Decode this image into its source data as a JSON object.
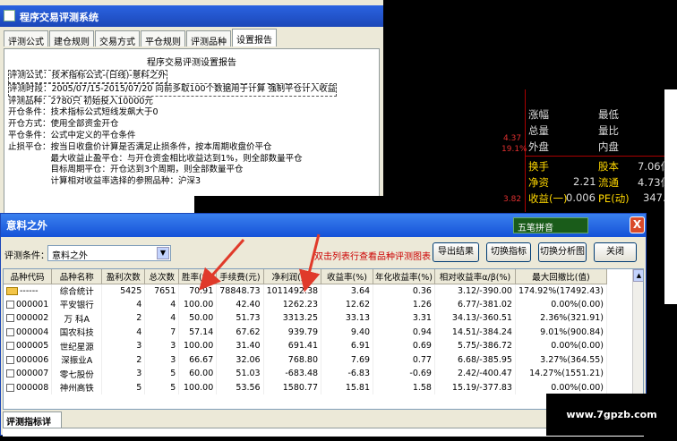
{
  "back_window": {
    "title": "程序交易评测系统",
    "tabs": [
      "评测公式",
      "建仓规则",
      "交易方式",
      "平仓规则",
      "评测品种",
      "设置报告"
    ],
    "report_title": "程序交易评测设置报告",
    "lines": [
      "评测公式：技术指标公式-(日线)-意料之外",
      "评测时段：2005/07/15-2015/07/20  向前多取100个数据用于计算  强制平仓计入收益",
      "评测品种：2780只  初始投入10000元",
      "开仓条件：技术指标公式短线发飙大于0",
      "开仓方式：使用全部资金开仓",
      "平仓条件：公式中定义的平仓条件",
      "止损平仓：按当日收盘价计算是否满足止损条件，按本周期收盘价平仓",
      "　　　　　最大收益止盈平仓：与开仓资金相比收益达到1%，则全部数量平仓",
      "　　　　　目标周期平仓：开仓达到3个周期，则全部数量平仓",
      "　　　　　计算相对收益率选择的参照品种：沪深3"
    ]
  },
  "stock_panel": {
    "items": [
      {
        "label": "涨幅",
        "label2": "最低"
      },
      {
        "label": "总量",
        "label2": "量比"
      },
      {
        "label": "外盘",
        "label2": "内盘"
      },
      {
        "label": "换手",
        "label2": "股本",
        "value2": "7.06亿"
      },
      {
        "label": "净资",
        "value": "2.21",
        "label2": "流通",
        "value2": "4.73亿"
      },
      {
        "label": "收益(一)",
        "value": "0.006",
        "label2": "PE(动)",
        "value2": "347.1"
      }
    ],
    "left_values": [
      "4.37",
      "19.1%",
      "3.82"
    ]
  },
  "main_window": {
    "title": "意料之外",
    "ime_label": "五笔拼音",
    "close_label": "X",
    "condition_label": "评测条件：",
    "condition_value": "意料之外",
    "hint": "双击列表行查看品种评测图表",
    "buttons": {
      "export": "导出结果",
      "switch_indicator": "切换指标",
      "switch_chart": "切换分析图",
      "close": "关闭"
    },
    "columns": [
      "品种代码",
      "品种名称",
      "盈利次数",
      "总次数",
      "胜率(%)",
      "手续费(元)",
      "净利润(元)",
      "收益率(%)",
      "年化收益率(%)",
      "相对收益率α/β(%)",
      "最大回撤比(值)"
    ],
    "rows": [
      [
        "------",
        "综合统计",
        "5425",
        "7651",
        "70.91",
        "78848.73",
        "1011492.38",
        "3.64",
        "0.36",
        "3.12/-390.00",
        "174.92%(17492.43)"
      ],
      [
        "000001",
        "平安银行",
        "4",
        "4",
        "100.00",
        "42.40",
        "1262.23",
        "12.62",
        "1.26",
        "6.77/-381.02",
        "0.00%(0.00)"
      ],
      [
        "000002",
        "万  科A",
        "2",
        "4",
        "50.00",
        "51.73",
        "3313.25",
        "33.13",
        "3.31",
        "34.13/-360.51",
        "2.36%(321.91)"
      ],
      [
        "000004",
        "国农科技",
        "4",
        "7",
        "57.14",
        "67.62",
        "939.79",
        "9.40",
        "0.94",
        "14.51/-384.24",
        "9.01%(900.84)"
      ],
      [
        "000005",
        "世纪星源",
        "3",
        "3",
        "100.00",
        "31.40",
        "691.41",
        "6.91",
        "0.69",
        "5.75/-386.72",
        "0.00%(0.00)"
      ],
      [
        "000006",
        "深振业A",
        "2",
        "3",
        "66.67",
        "32.06",
        "768.80",
        "7.69",
        "0.77",
        "6.68/-385.95",
        "3.27%(364.55)"
      ],
      [
        "000007",
        "零七股份",
        "3",
        "5",
        "60.00",
        "51.03",
        "-683.48",
        "-6.83",
        "-0.69",
        "2.42/-400.47",
        "14.27%(1551.21)"
      ],
      [
        "000008",
        "神州高铁",
        "5",
        "5",
        "100.00",
        "53.56",
        "1580.77",
        "15.81",
        "1.58",
        "15.19/-377.83",
        "0.00%(0.00)"
      ]
    ],
    "detail_tab": "评测指标详情"
  },
  "watermark": "www.7gpzb.com",
  "colors": {
    "title_blue": "#1552d8",
    "window_bg": "#ECE9D8",
    "arrow_red": "#e03a2a",
    "stock_red": "#e03030",
    "stock_yellow": "#ffd700"
  }
}
